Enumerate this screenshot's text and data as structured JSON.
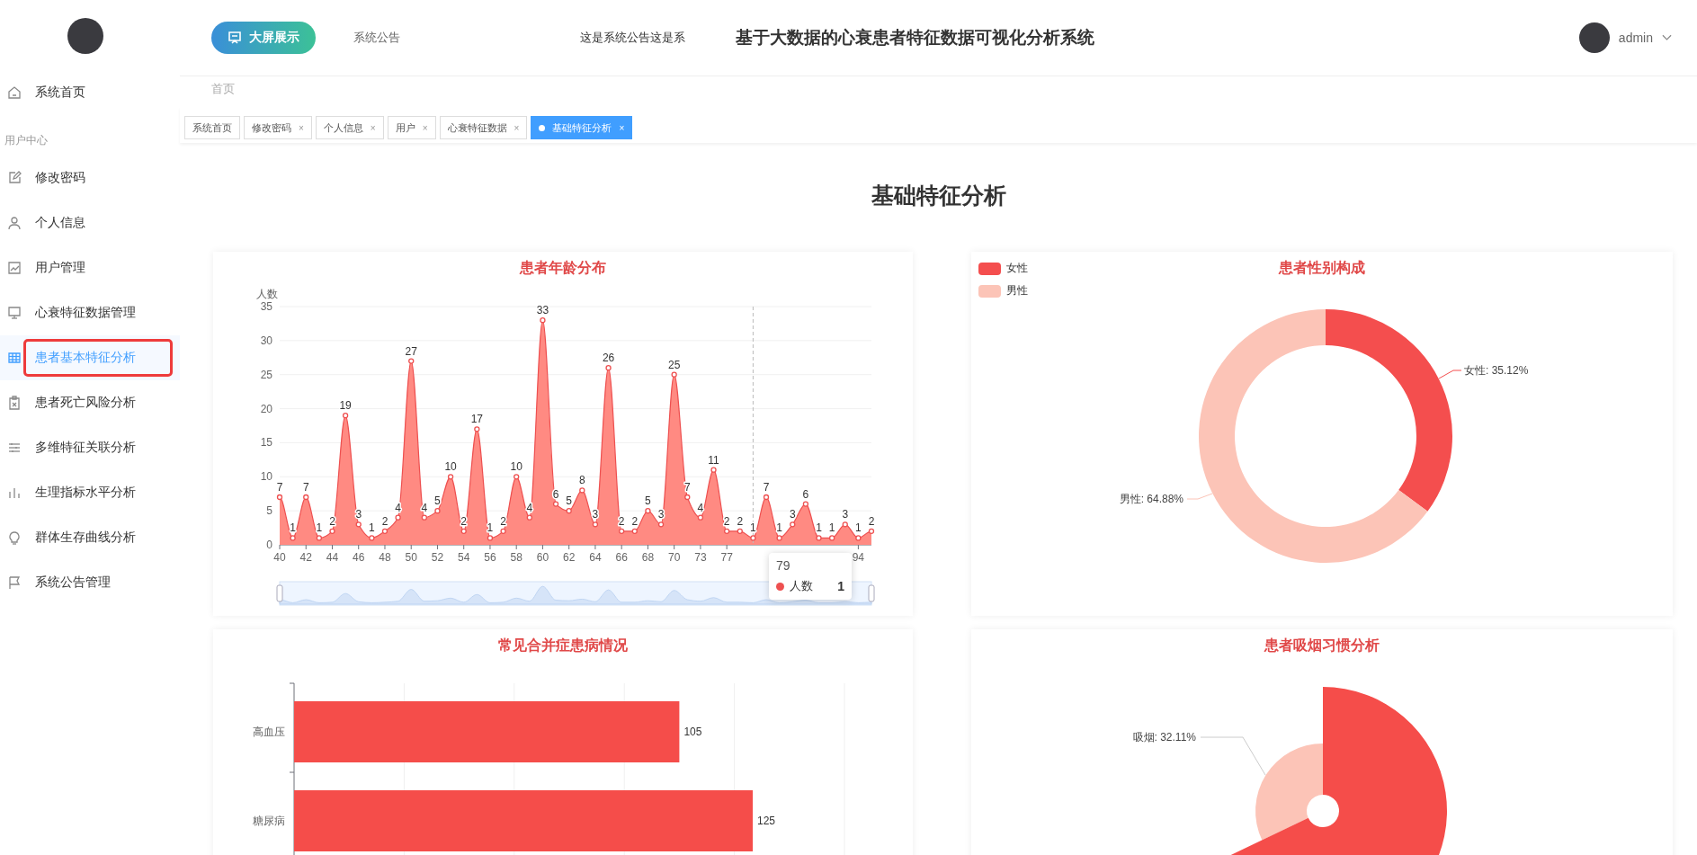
{
  "sidebar": {
    "home": {
      "label": "系统首页",
      "selected": false
    },
    "group_label": "用户中心",
    "items": [
      {
        "label": "修改密码",
        "selected": false
      },
      {
        "label": "个人信息",
        "selected": false
      },
      {
        "label": "用户管理",
        "selected": false
      },
      {
        "label": "心衰特征数据管理",
        "selected": false
      },
      {
        "label": "患者基本特征分析",
        "selected": true
      },
      {
        "label": "患者死亡风险分析",
        "selected": false
      },
      {
        "label": "多维特征关联分析",
        "selected": false
      },
      {
        "label": "生理指标水平分析",
        "selected": false
      },
      {
        "label": "群体生存曲线分析",
        "selected": false
      },
      {
        "label": "系统公告管理",
        "selected": false
      }
    ]
  },
  "header": {
    "big_screen_button": "大屏展示",
    "notice_label": "系统公告",
    "notice_text": "这是系统公告这是系",
    "title": "基于大数据的心衰患者特征数据可视化分析系统",
    "user": "admin"
  },
  "breadcrumb": [
    "首页"
  ],
  "tabs": [
    {
      "label": "系统首页",
      "selected": false
    },
    {
      "label": "修改密码",
      "close": "×",
      "selected": false
    },
    {
      "label": "个人信息",
      "close": "×",
      "selected": false
    },
    {
      "label": "用户",
      "close": "×",
      "selected": false
    },
    {
      "label": "心衰特征数据",
      "close": "×",
      "selected": false
    },
    {
      "label": "基础特征分析",
      "close": "×",
      "selected": true
    }
  ],
  "page_title": "基础特征分析",
  "age_chart": {
    "chart_data": {
      "type": "area",
      "title": "患者年龄分布",
      "ylabel": "人数",
      "ylim": [
        0,
        35
      ],
      "yticks": [
        0,
        5,
        10,
        15,
        20,
        25,
        30,
        35
      ],
      "grid": true,
      "categories": [
        "40",
        null,
        "42",
        null,
        "44",
        null,
        "46",
        null,
        "48",
        null,
        "50",
        null,
        "52",
        null,
        "54",
        null,
        "56",
        null,
        "58",
        null,
        "60",
        null,
        "62",
        null,
        "64",
        null,
        "66",
        null,
        "68",
        null,
        "70",
        null,
        "73",
        null,
        "77",
        null,
        null,
        null,
        null,
        null,
        null,
        null,
        null,
        null,
        "94",
        null
      ],
      "series": [
        {
          "name": "人数",
          "color": "#ee5050",
          "values": [
            7,
            1,
            7,
            1,
            2,
            19,
            3,
            1,
            2,
            4,
            27,
            4,
            5,
            10,
            2,
            17,
            1,
            2,
            10,
            4,
            33,
            6,
            5,
            8,
            3,
            26,
            2,
            2,
            5,
            3,
            25,
            7,
            4,
            11,
            2,
            2,
            1,
            7,
            1,
            3,
            6,
            1,
            1,
            3,
            1,
            2
          ]
        }
      ],
      "data_labels": true
    },
    "tooltip": {
      "title": "79",
      "value": "1"
    }
  },
  "gender_chart": {
    "chart_data": {
      "type": "donut",
      "title": "患者性别构成",
      "categories": [
        "女性",
        "男性"
      ],
      "values": [
        35.12,
        64.88
      ],
      "value_labels": [
        "女性: 35.12%",
        "男性: 64.88%"
      ]
    }
  },
  "comorbidity_chart": {
    "chart_data": {
      "type": "bar",
      "orientation": "horizontal",
      "title": "常见合并症患病情况",
      "categories": [
        "高血压",
        "糖尿病"
      ],
      "values": [
        105,
        125
      ],
      "value_labels": [
        "105",
        "125"
      ]
    }
  },
  "smoking_chart": {
    "title": "患者吸烟习惯分析",
    "kind": "rose",
    "slice_label": "吸烟: 32.11%"
  }
}
